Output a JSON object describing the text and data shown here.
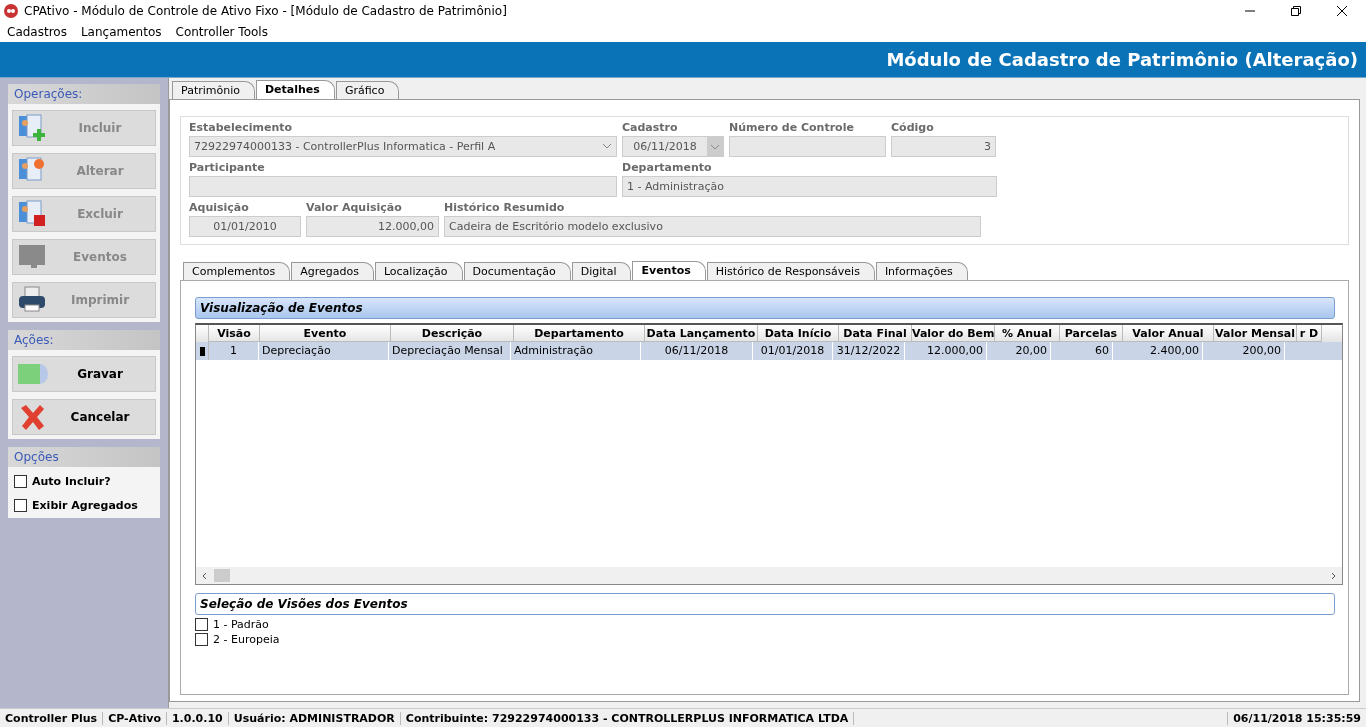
{
  "window": {
    "title": "CPAtivo - Módulo de Controle de Ativo Fixo - [Módulo de Cadastro de Patrimônio]",
    "kind": "app"
  },
  "menu": [
    "Cadastros",
    "Lançamentos",
    "Controller Tools"
  ],
  "banner": {
    "title": "Módulo de Cadastro de Patrimônio (Alteração)"
  },
  "sidebar": {
    "groups": [
      {
        "title": "Operações:",
        "buttons": [
          {
            "label": "Incluir",
            "disabled": true
          },
          {
            "label": "Alterar",
            "disabled": true
          },
          {
            "label": "Excluir",
            "disabled": true
          },
          {
            "label": "Eventos",
            "disabled": true
          },
          {
            "label": "Imprimir",
            "disabled": true
          }
        ]
      },
      {
        "title": "Ações:",
        "buttons": [
          {
            "label": "Gravar",
            "disabled": false
          },
          {
            "label": "Cancelar",
            "disabled": false
          }
        ]
      },
      {
        "title": "Opções",
        "checkboxes": [
          {
            "label": "Auto Incluir?",
            "checked": false
          },
          {
            "label": "Exibir Agregados",
            "checked": false
          }
        ]
      }
    ]
  },
  "main_tabs": [
    {
      "label": "Patrimônio",
      "selected": false
    },
    {
      "label": "Detalhes",
      "selected": true
    },
    {
      "label": "Gráfico",
      "selected": false
    }
  ],
  "form": {
    "estabelecimento": {
      "label": "Estabelecimento",
      "value": "72922974000133 - ControllerPlus Informatica - Perfil A"
    },
    "cadastro": {
      "label": "Cadastro",
      "value": "06/11/2018"
    },
    "numero_controle": {
      "label": "Número de Controle"
    },
    "codigo": {
      "label": "Código",
      "value": "3"
    },
    "participante": {
      "label": "Participante"
    },
    "departamento": {
      "label": "Departamento",
      "value": "1 - Administração"
    },
    "aquisicao": {
      "label": "Aquisição",
      "value": "01/01/2010"
    },
    "valor_aquisicao": {
      "label": "Valor Aquisição",
      "value": "12.000,00"
    },
    "historico": {
      "label": "Histórico Resumido",
      "value": "Cadeira de Escritório modelo exclusivo"
    }
  },
  "sub_tabs": [
    {
      "label": "Complementos",
      "selected": false
    },
    {
      "label": "Agregados",
      "selected": false
    },
    {
      "label": "Localização",
      "selected": false
    },
    {
      "label": "Documentação",
      "selected": false
    },
    {
      "label": "Digital",
      "selected": false
    },
    {
      "label": "Eventos",
      "selected": true
    },
    {
      "label": "Histórico de Responsáveis",
      "selected": false
    },
    {
      "label": "Informações",
      "selected": false
    }
  ],
  "events_panel": {
    "title": "Visualização de Eventos",
    "columns": [
      {
        "label": "Visão"
      },
      {
        "label": "Evento"
      },
      {
        "label": "Descrição"
      },
      {
        "label": "Departamento"
      },
      {
        "label": "Data Lançamento"
      },
      {
        "label": "Data Início"
      },
      {
        "label": "Data Final"
      },
      {
        "label": "Valor do Bem"
      },
      {
        "label": "% Anual"
      },
      {
        "label": "Parcelas"
      },
      {
        "label": "Valor Anual"
      },
      {
        "label": "Valor Mensal"
      },
      {
        "label": "r D"
      }
    ],
    "rows": [
      {
        "selected": true,
        "cells": [
          {
            "text": "1"
          },
          {
            "text": "Depreciação"
          },
          {
            "text": "Depreciação Mensal"
          },
          {
            "text": "Administração"
          },
          {
            "text": "06/11/2018"
          },
          {
            "text": "01/01/2018"
          },
          {
            "text": "31/12/2022"
          },
          {
            "text": "12.000,00"
          },
          {
            "text": "20,00"
          },
          {
            "text": "60"
          },
          {
            "text": "2.400,00"
          },
          {
            "text": "200,00"
          }
        ]
      }
    ]
  },
  "views_panel": {
    "title": "Seleção de Visões dos Eventos",
    "options": [
      {
        "label": "1 - Padrão",
        "checked": false
      },
      {
        "label": "2 - Europeia",
        "checked": false
      }
    ]
  },
  "status_bar": [
    {
      "text": "Controller Plus"
    },
    {
      "text": "CP-Ativo"
    },
    {
      "text": "1.0.0.10"
    },
    {
      "text": "Usuário: ADMINISTRADOR"
    },
    {
      "text": "Contribuinte: 72922974000133 - CONTROLLERPLUS INFORMATICA LTDA"
    },
    {
      "text": "06/11/2018 15:35:59",
      "kind": "clock"
    }
  ]
}
